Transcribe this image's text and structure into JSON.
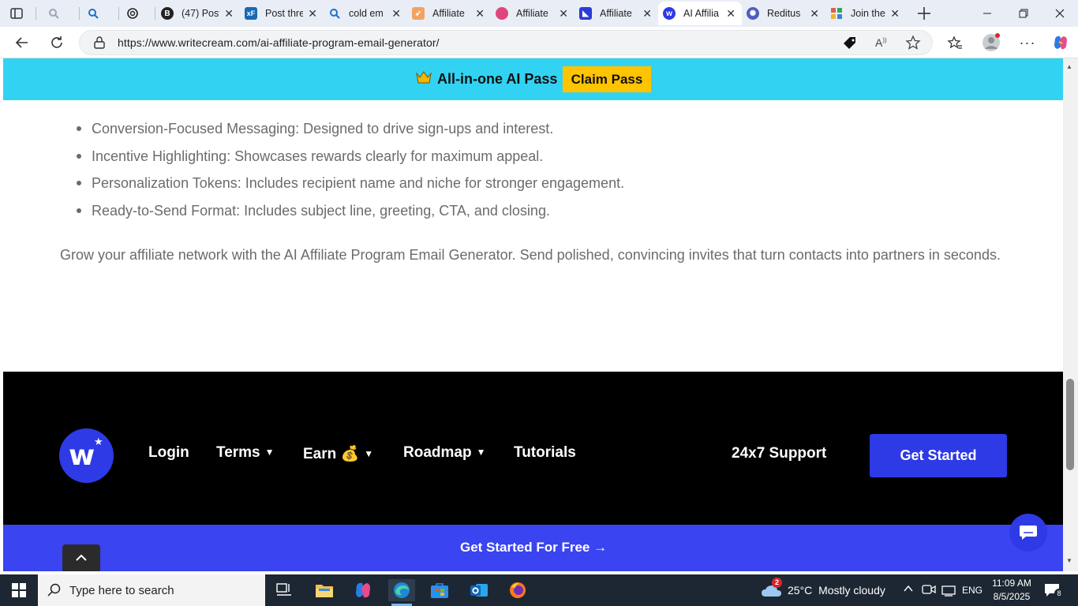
{
  "browser": {
    "tabs": [
      {
        "title": "",
        "favicon": "search-icon",
        "color": "#5c6b7a"
      },
      {
        "title": "",
        "favicon": "search-icon",
        "color": "#1a6fd1"
      },
      {
        "title": "",
        "favicon": "openai-icon",
        "color": "#222222"
      },
      {
        "title": "(47) Post",
        "favicon": "b-icon",
        "color": "#222222"
      },
      {
        "title": "Post thre",
        "favicon": "xf-icon",
        "color": "#1769b5"
      },
      {
        "title": "cold em",
        "favicon": "search-icon",
        "color": "#1a6fd1"
      },
      {
        "title": "Affiliate",
        "favicon": "rocket-icon",
        "color": "#d9552b"
      },
      {
        "title": "Affiliate",
        "favicon": "circle-icon",
        "color": "#e0457b"
      },
      {
        "title": "Affiliate",
        "favicon": "arrow-logo-icon",
        "color": "#2a3bd6"
      },
      {
        "title": "AI Affilia",
        "favicon": "writecream-icon",
        "color": "#2d3ae6",
        "active": true
      },
      {
        "title": "Reditus",
        "favicon": "reditus-icon",
        "color": "#4b5fc2"
      },
      {
        "title": "Join the",
        "favicon": "grid-icon",
        "color": "#d84a3a"
      }
    ],
    "url": "https://www.writecream.com/ai-affiliate-program-email-generator/"
  },
  "page": {
    "promo": {
      "icon": "crown-icon",
      "text": "All-in-one AI Pass",
      "button": "Claim Pass"
    },
    "bullets": [
      "Conversion-Focused Messaging: Designed to drive sign-ups and interest.",
      "Incentive Highlighting: Showcases rewards clearly for maximum appeal.",
      "Personalization Tokens: Includes recipient name and niche for stronger engagement.",
      "Ready-to-Send Format: Includes subject line, greeting, CTA, and closing."
    ],
    "closing": "Grow your affiliate network with the AI Affiliate Program Email Generator. Send polished, convincing invites that turn contacts into partners in seconds.",
    "footer": {
      "logo_letter": "w",
      "nav": {
        "login": "Login",
        "terms": "Terms",
        "earn": "Earn 💰",
        "roadmap": "Roadmap",
        "tutorials": "Tutorials"
      },
      "support": "24x7 Support",
      "get_started": "Get Started"
    },
    "cta": "Get Started For Free  →"
  },
  "taskbar": {
    "search_placeholder": "Type here to search",
    "weather_temp": "25°C",
    "weather_desc": "Mostly cloudy",
    "weather_badge": "2",
    "lang": "ENG",
    "time": "11:09 AM",
    "date": "8/5/2025",
    "notification_count": "8"
  }
}
